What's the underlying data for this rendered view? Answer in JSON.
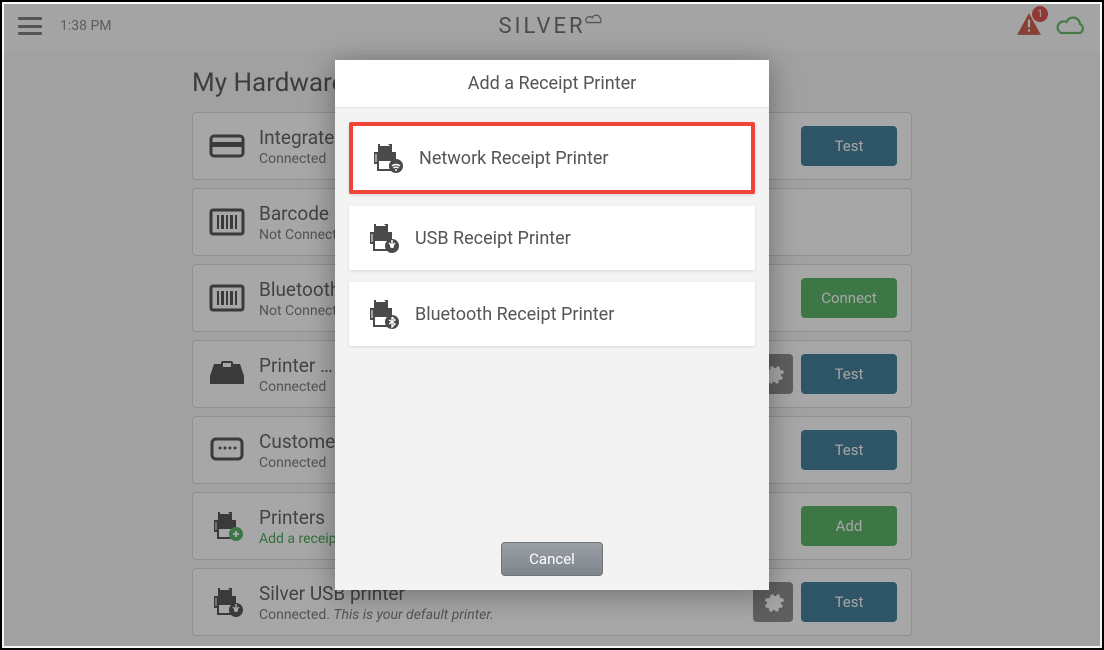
{
  "header": {
    "time": "1:38 PM",
    "logo": "SILVER",
    "alert_count": "1"
  },
  "page": {
    "title": "My Hardware"
  },
  "hardware": [
    {
      "name": "Integrated …",
      "status": "Connected",
      "button": "Test",
      "btn_class": "btn-blue",
      "gear": false,
      "icon": "card",
      "green": false
    },
    {
      "name": "Barcode …",
      "status": "Not Connected",
      "button": "",
      "btn_class": "",
      "gear": false,
      "icon": "barcode",
      "green": false
    },
    {
      "name": "Bluetooth …",
      "status": "Not Connected",
      "button": "Connect",
      "btn_class": "btn-green",
      "gear": false,
      "icon": "barcode",
      "green": false
    },
    {
      "name": "Printer …",
      "status": "Connected",
      "button": "Test",
      "btn_class": "btn-blue",
      "gear": true,
      "icon": "cash-drawer",
      "green": false
    },
    {
      "name": "Customer …",
      "status": "Connected",
      "button": "Test",
      "btn_class": "btn-blue",
      "gear": false,
      "icon": "display",
      "green": false
    },
    {
      "name": "Printers",
      "status": "Add a receipt printer",
      "button": "Add",
      "btn_class": "btn-green",
      "gear": false,
      "icon": "printer-add",
      "green": true
    },
    {
      "name": "Silver USB printer",
      "status_prefix": "Connected.",
      "status_default": "This is your default printer.",
      "button": "Test",
      "btn_class": "btn-blue",
      "gear": true,
      "icon": "printer-usb",
      "green": false
    }
  ],
  "modal": {
    "title": "Add a Receipt Printer",
    "options": [
      {
        "label": "Network Receipt Printer",
        "icon": "printer-wifi",
        "highlighted": true
      },
      {
        "label": "USB Receipt Printer",
        "icon": "printer-usb",
        "highlighted": false
      },
      {
        "label": "Bluetooth Receipt Printer",
        "icon": "printer-bt",
        "highlighted": false
      }
    ],
    "cancel": "Cancel"
  }
}
